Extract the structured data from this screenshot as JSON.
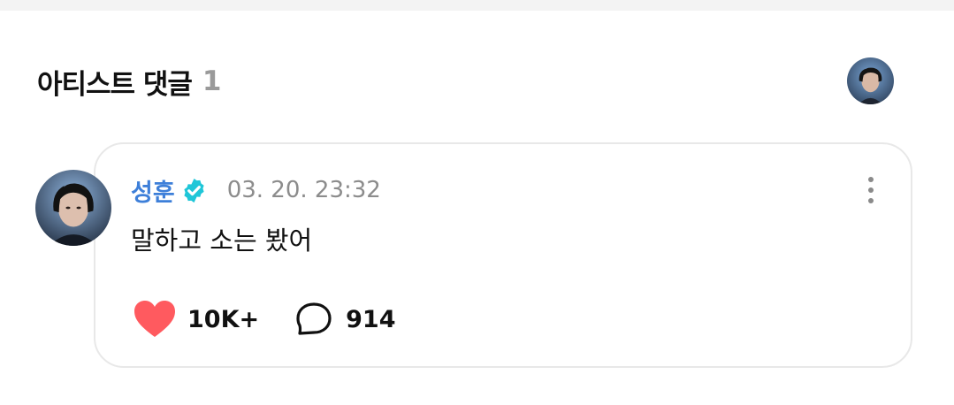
{
  "section": {
    "title": "아티스트 댓글",
    "count": "1"
  },
  "comment": {
    "author": "성훈",
    "verified": true,
    "timestamp": "03. 20. 23:32",
    "text": "말하고 소는 봤어",
    "likes": "10K+",
    "replies": "914"
  },
  "colors": {
    "author_name": "#3d7fd9",
    "verified_badge": "#1fc6d8",
    "heart": "#ff5a5f",
    "card_border": "#e8e8e8",
    "muted_text": "#8c8c8c"
  },
  "icons": {
    "header_avatar": "artist-avatar",
    "verified": "verified-check-badge-icon",
    "more": "more-vertical-icon",
    "like": "heart-icon",
    "reply": "chat-bubble-icon"
  }
}
